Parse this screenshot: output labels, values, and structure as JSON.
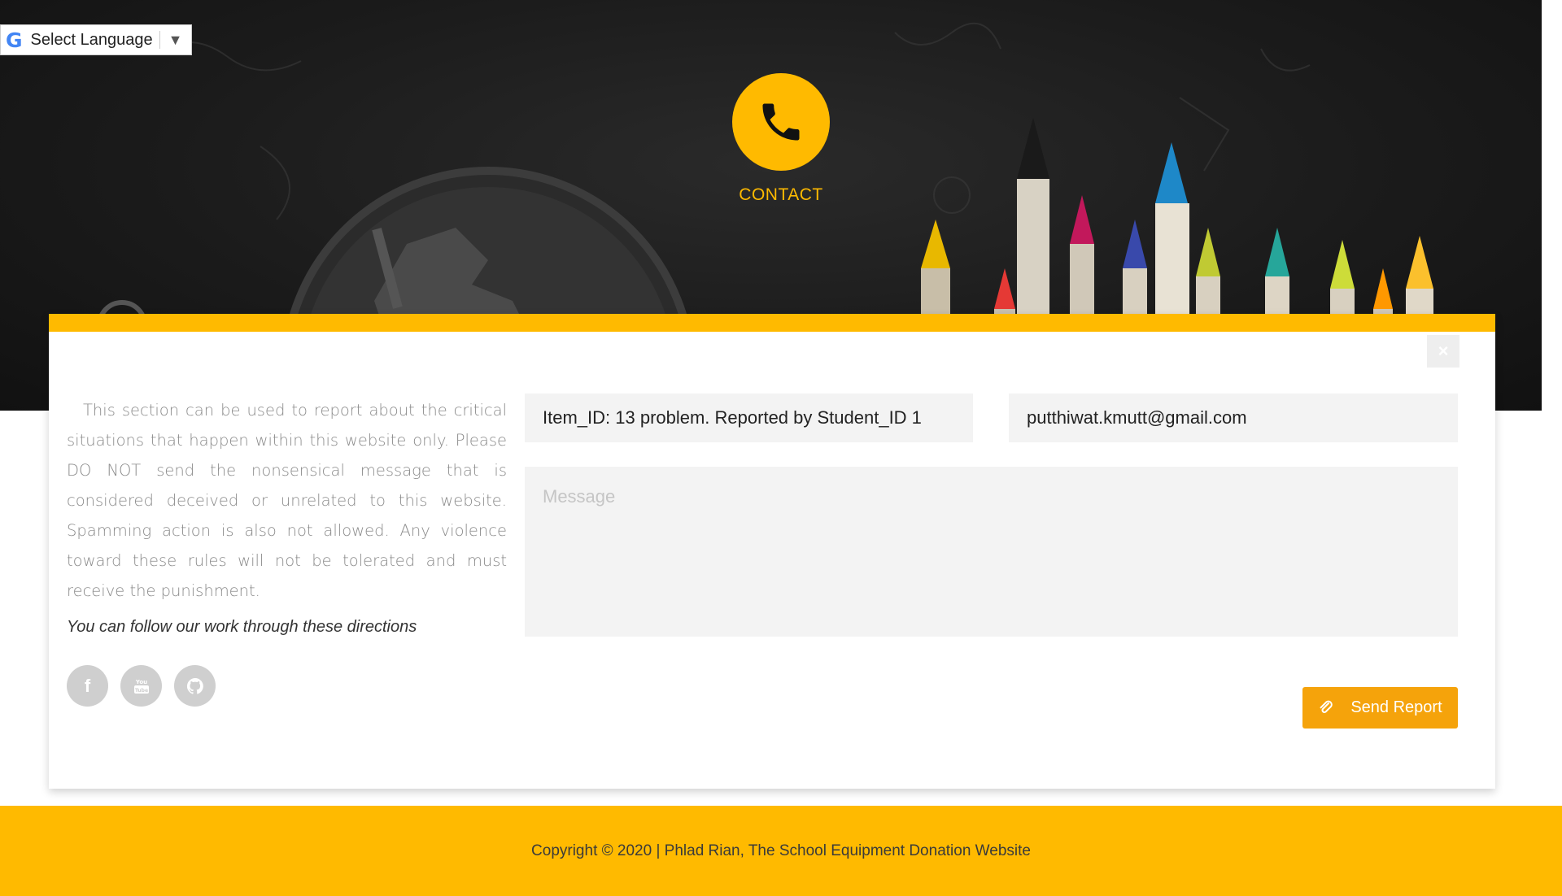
{
  "language_selector": {
    "label": "Select Language",
    "google_mark": "G",
    "arrow": "▼"
  },
  "hero": {
    "title": "CONTACT",
    "icon": "phone-icon",
    "accent_color": "#FFBA00"
  },
  "report_card": {
    "close_icon": "×",
    "description": "This section can be used to report about the critical situations that happen within this website only. Please DO NOT send the nonsensical message that is considered deceived or unrelated to this website. Spamming action is also not allowed. Any violence toward these rules will not be tolerated and must receive the punishment.",
    "follow_text": "You can follow our work through these directions",
    "socials": [
      {
        "name": "facebook-icon",
        "glyph": "f"
      },
      {
        "name": "youtube-icon",
        "glyph": "You\nTube"
      },
      {
        "name": "github-icon",
        "glyph": "gh"
      }
    ],
    "subject_value": "Item_ID: 13 problem. Reported by Student_ID 1",
    "email_value": "putthiwat.kmutt@gmail.com",
    "message_placeholder": "Message",
    "send_label": "Send Report",
    "send_color": "#F5A30B"
  },
  "footer": {
    "text": "Copyright © 2020 | Phlad Rian, The School Equipment Donation Website"
  }
}
